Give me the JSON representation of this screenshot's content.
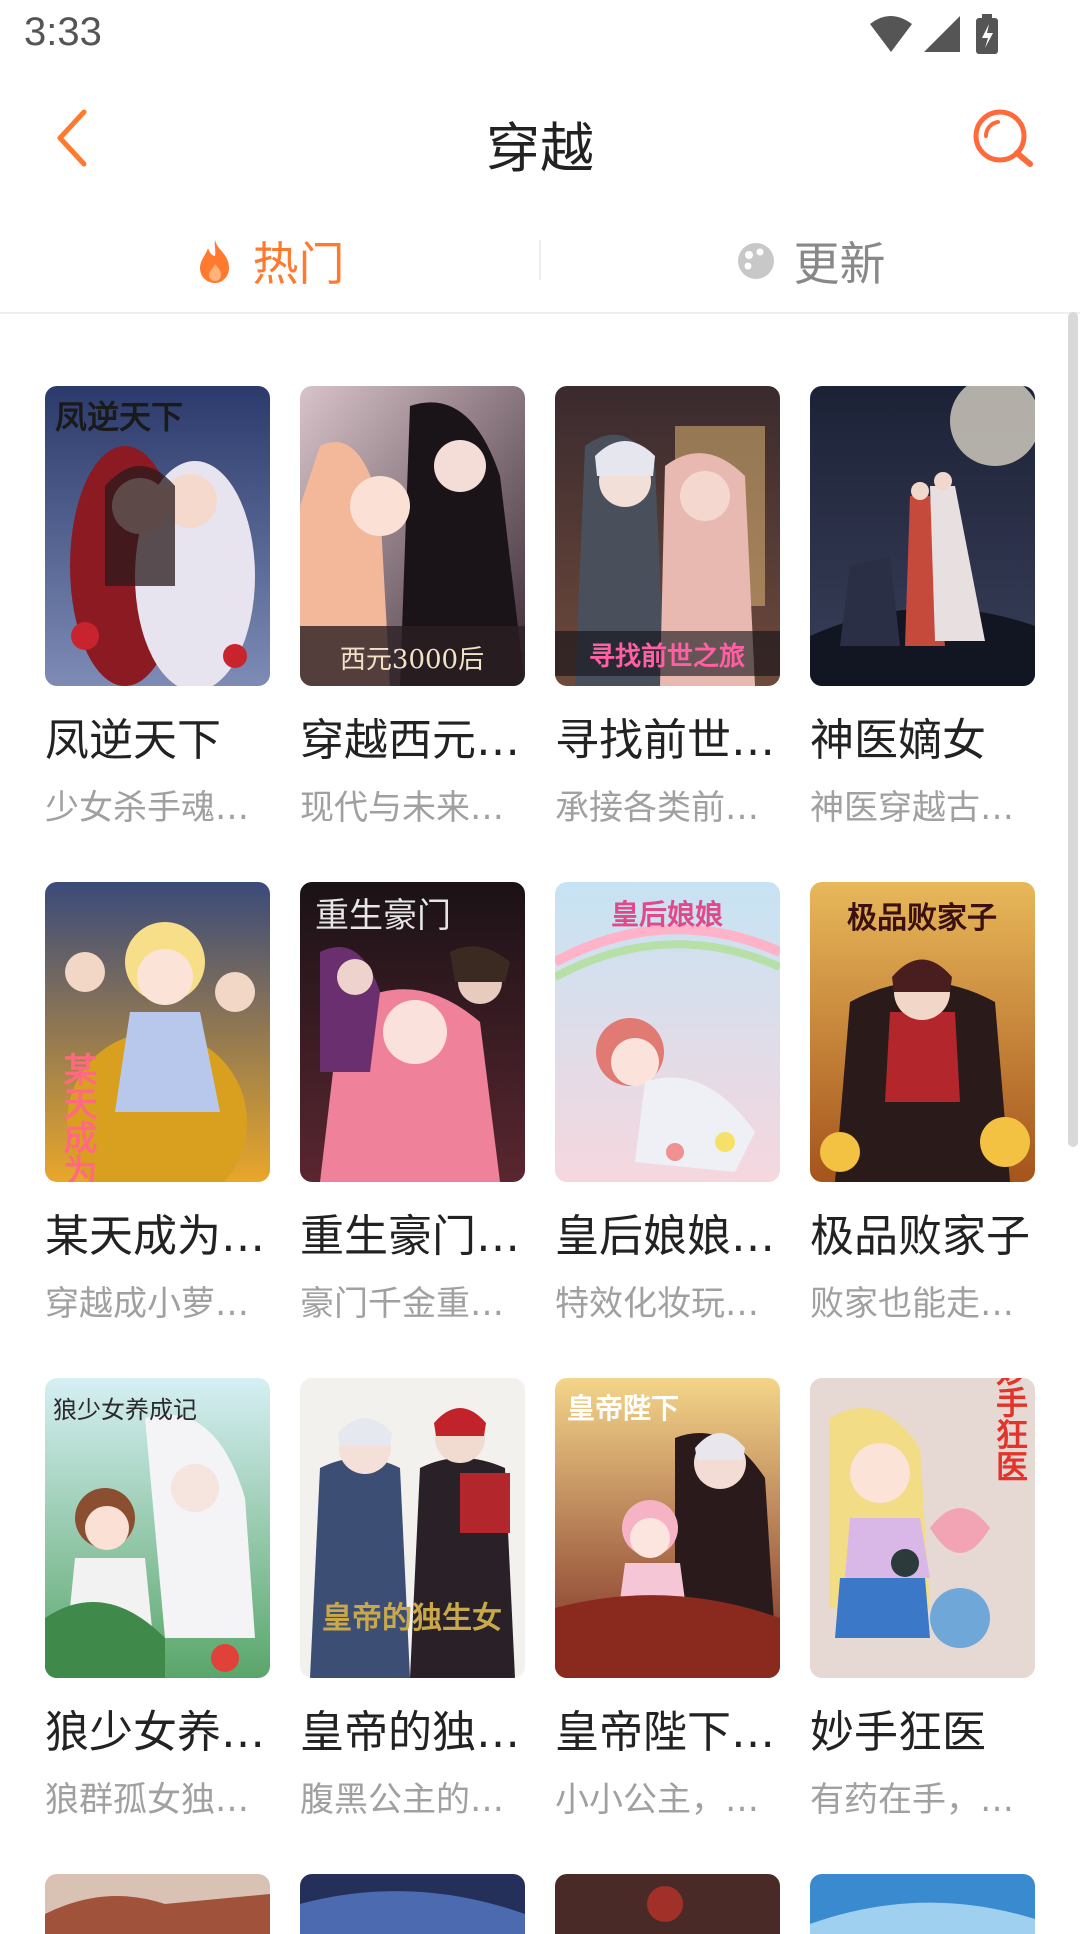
{
  "status_bar": {
    "time": "3:33"
  },
  "header": {
    "title": "穿越"
  },
  "tabs": [
    {
      "label": "热门",
      "active": true,
      "icon": "flame-icon"
    },
    {
      "label": "更新",
      "active": false,
      "icon": "palette-icon"
    }
  ],
  "colors": {
    "accent": "#ff7a2e",
    "muted": "#a0a0a0",
    "title": "#222222"
  },
  "comics": [
    {
      "title": "凤逆天下",
      "desc": "少女杀手魂…",
      "cover_text": "凤逆天下"
    },
    {
      "title": "穿越西元…",
      "desc": "现代与未来…",
      "cover_text": "西元3000后"
    },
    {
      "title": "寻找前世…",
      "desc": "承接各类前…",
      "cover_text": "寻找前世之旅"
    },
    {
      "title": "神医嫡女",
      "desc": "神医穿越古…",
      "cover_text": ""
    },
    {
      "title": "某天成为…",
      "desc": "穿越成小萝…",
      "cover_text": "某天成为"
    },
    {
      "title": "重生豪门…",
      "desc": "豪门千金重…",
      "cover_text": "重生豪门"
    },
    {
      "title": "皇后娘娘…",
      "desc": "特效化妆玩…",
      "cover_text": "皇后娘娘"
    },
    {
      "title": "极品败家子",
      "desc": "败家也能走…",
      "cover_text": "极品败家子"
    },
    {
      "title": "狼少女养…",
      "desc": "狼群孤女独…",
      "cover_text": "狼少女养成记"
    },
    {
      "title": "皇帝的独…",
      "desc": "腹黑公主的…",
      "cover_text": "皇帝的独生女"
    },
    {
      "title": "皇帝陛下…",
      "desc": "小小公主，…",
      "cover_text": "皇帝陛下"
    },
    {
      "title": "妙手狂医",
      "desc": "有药在手，…",
      "cover_text": "妙手狂医"
    }
  ]
}
